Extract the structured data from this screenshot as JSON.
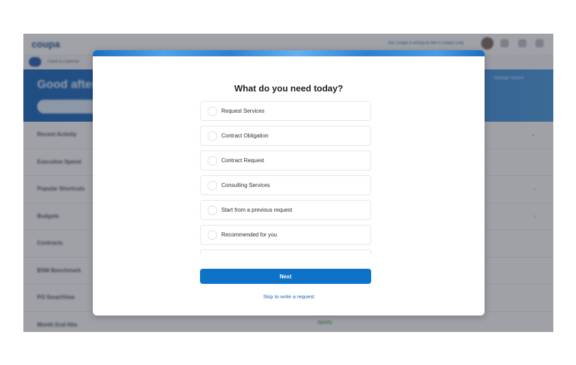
{
  "background": {
    "logo": "coupa",
    "top_links": "Ask Coupa is acting as like a Coupa Corp",
    "subbar_text": "Travel & Expense",
    "greeting": "Good afternoon",
    "hero_links": "Manage   Review",
    "sidebar": [
      {
        "label": "Recent Activity",
        "chevron": "⌄"
      },
      {
        "label": "Executive Spend",
        "chevron": ""
      },
      {
        "label": "Popular Shortcuts",
        "chevron": "›"
      },
      {
        "label": "Budgets",
        "chevron": "›"
      },
      {
        "label": "Contracts",
        "chevron": ""
      },
      {
        "label": "BSM Benchmark",
        "chevron": ""
      },
      {
        "label": "PO SmartView",
        "chevron": ""
      },
      {
        "label": "Month End Hits",
        "chevron": ""
      }
    ],
    "spotify_label": "Spotify"
  },
  "modal": {
    "title": "What do you need today?",
    "options": [
      "Request Services",
      "Contract Obligation",
      "Contract Request",
      "Consulting Services",
      "Start from a previous request",
      "Recommended for you",
      ""
    ],
    "next_label": "Next",
    "skip_label": "Skip to write a request"
  },
  "colors": {
    "primary_button": "#0d73c9",
    "link": "#1a64b8",
    "hero_blue": "#1a64b8"
  }
}
